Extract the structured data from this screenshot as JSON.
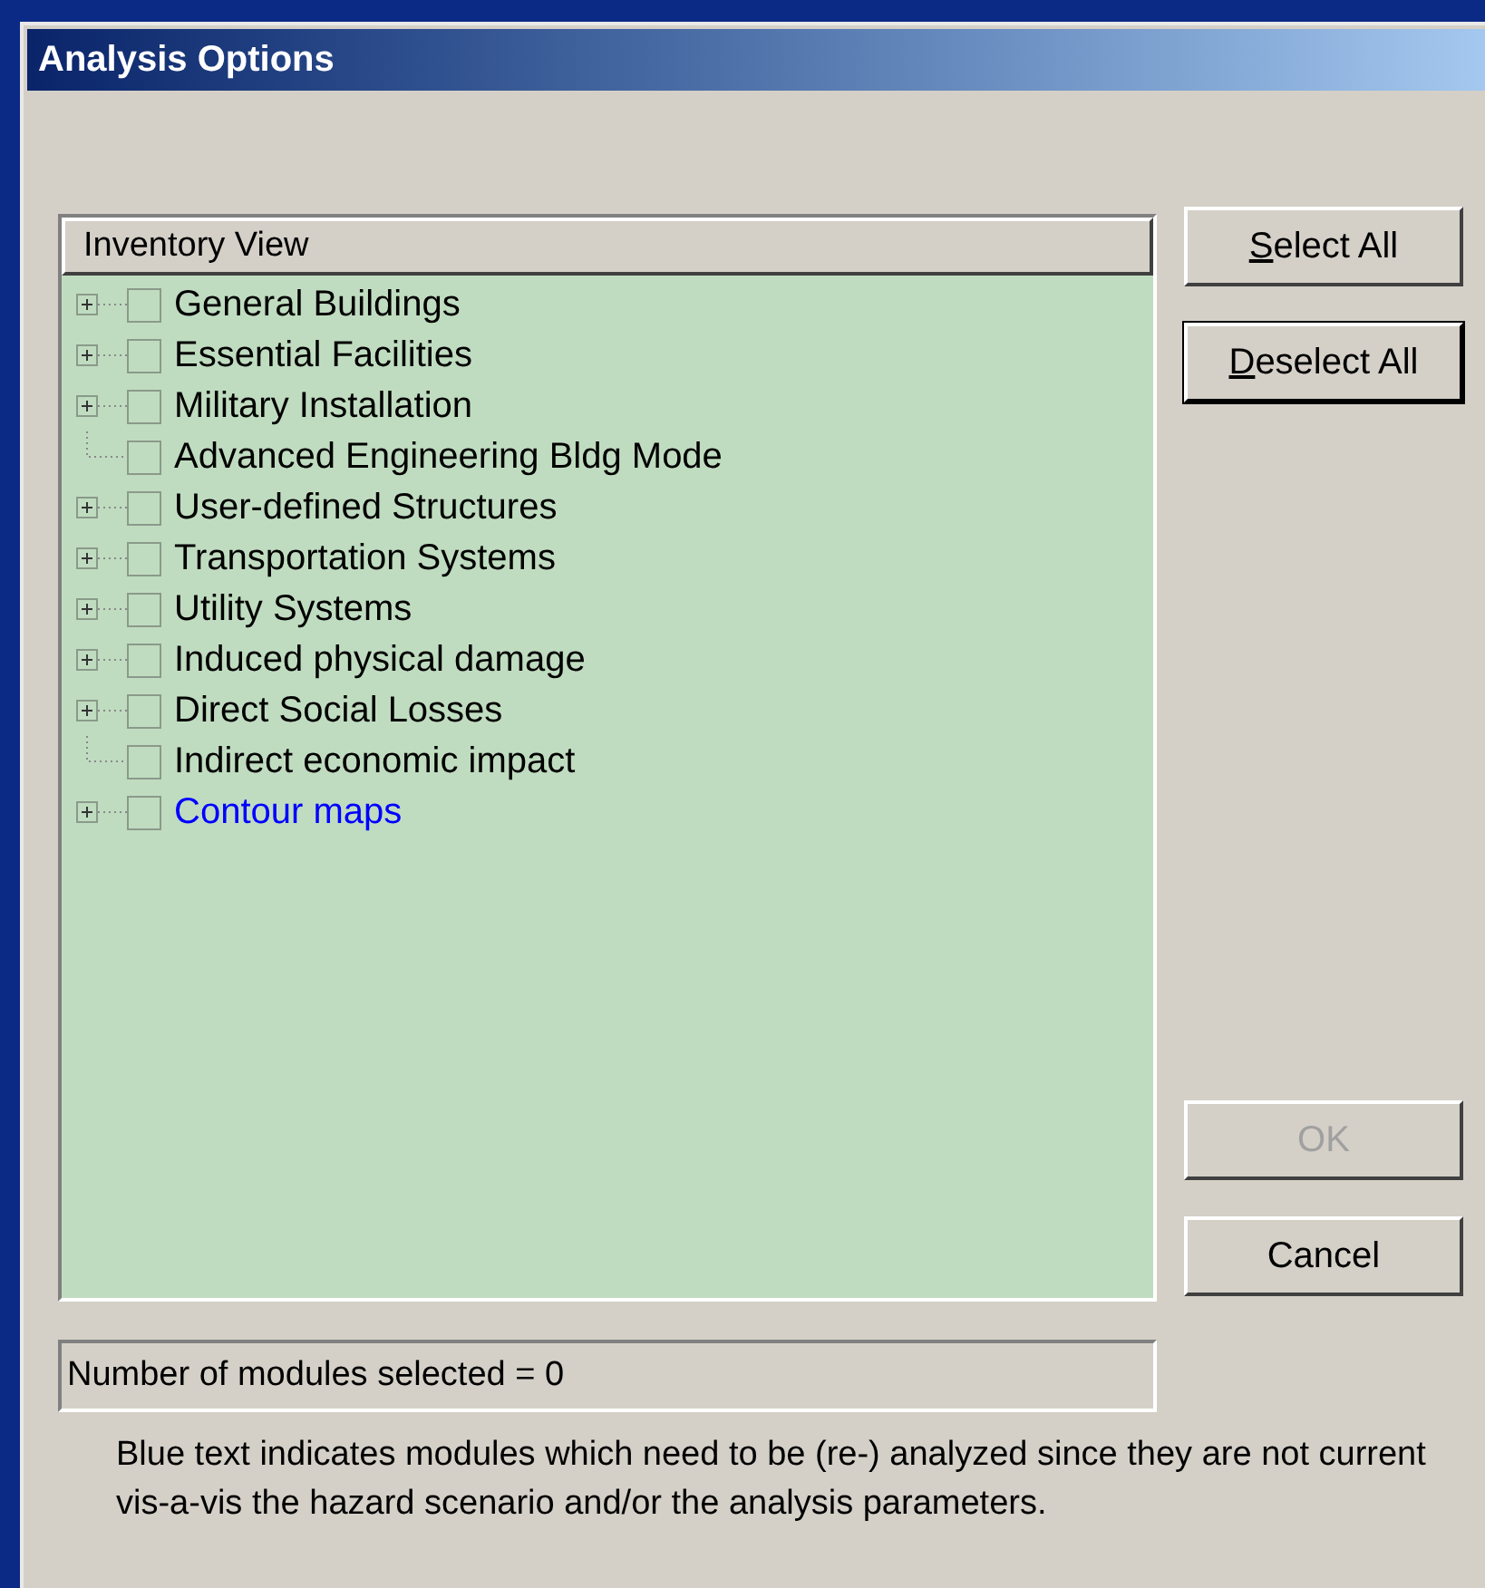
{
  "window": {
    "title": "Analysis Options"
  },
  "tree": {
    "header": "Inventory View",
    "items": [
      {
        "label": "General Buildings",
        "expandable": true,
        "checked": false,
        "color": "#000000"
      },
      {
        "label": "Essential Facilities",
        "expandable": true,
        "checked": false,
        "color": "#000000"
      },
      {
        "label": "Military Installation",
        "expandable": true,
        "checked": false,
        "color": "#000000"
      },
      {
        "label": "Advanced Engineering Bldg Mode",
        "expandable": false,
        "checked": false,
        "color": "#000000"
      },
      {
        "label": "User-defined Structures",
        "expandable": true,
        "checked": false,
        "color": "#000000"
      },
      {
        "label": "Transportation Systems",
        "expandable": true,
        "checked": false,
        "color": "#000000"
      },
      {
        "label": "Utility Systems",
        "expandable": true,
        "checked": false,
        "color": "#000000"
      },
      {
        "label": "Induced physical damage",
        "expandable": true,
        "checked": false,
        "color": "#000000"
      },
      {
        "label": "Direct Social Losses",
        "expandable": true,
        "checked": false,
        "color": "#000000"
      },
      {
        "label": "Indirect economic impact",
        "expandable": false,
        "checked": false,
        "color": "#000000"
      },
      {
        "label": "Contour maps",
        "expandable": true,
        "checked": false,
        "color": "#0000ff"
      }
    ]
  },
  "top_buttons": [
    {
      "label": "Select All",
      "access_key_underlined": true,
      "disabled": false,
      "focused": false
    },
    {
      "label": "Deselect All",
      "access_key_underlined": true,
      "disabled": false,
      "focused": true
    }
  ],
  "bottom_buttons": [
    {
      "label": "OK",
      "disabled": true,
      "focused": false
    },
    {
      "label": "Cancel",
      "disabled": false,
      "focused": false
    }
  ],
  "status": "Number of modules selected = 0",
  "note": "Blue text indicates modules which need to be (re-) analyzed since they are not current vis-a-vis the hazard scenario and/or the analysis parameters."
}
